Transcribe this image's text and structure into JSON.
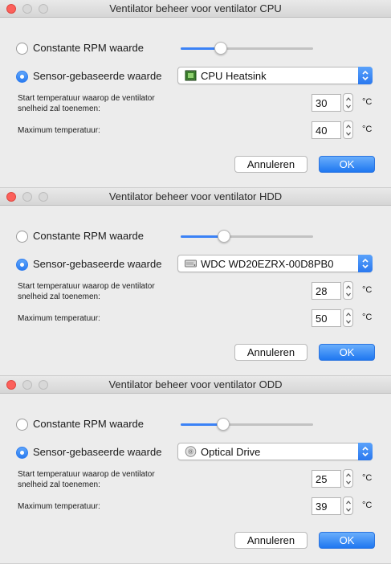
{
  "dialogs": [
    {
      "title": "Ventilator beheer voor ventilator CPU",
      "constant_label": "Constante RPM waarde",
      "sensor_label": "Sensor-gebaseerde waarde",
      "slider_level": 0.3,
      "selected_sensor": "CPU Heatsink",
      "sensor_icon": "chip-icon",
      "start_label_line1": "Start temperatuur waarop de ventilator",
      "start_label_line2": "snelheid zal toenemen:",
      "start_value": "30",
      "max_label": "Maximum temperatuur:",
      "max_value": "40",
      "unit": "°C",
      "cancel_label": "Annuleren",
      "ok_label": "OK"
    },
    {
      "title": "Ventilator beheer voor ventilator HDD",
      "constant_label": "Constante RPM waarde",
      "sensor_label": "Sensor-gebaseerde waarde",
      "slider_level": 0.33,
      "selected_sensor": "WDC WD20EZRX-00D8PB0",
      "sensor_icon": "hard-drive-icon",
      "start_label_line1": "Start temperatuur waarop de ventilator",
      "start_label_line2": "snelheid zal toenemen:",
      "start_value": "28",
      "max_label": "Maximum temperatuur:",
      "max_value": "50",
      "unit": "°C",
      "cancel_label": "Annuleren",
      "ok_label": "OK"
    },
    {
      "title": "Ventilator beheer voor ventilator ODD",
      "constant_label": "Constante RPM waarde",
      "sensor_label": "Sensor-gebaseerde waarde",
      "slider_level": 0.32,
      "selected_sensor": "Optical Drive",
      "sensor_icon": "optical-disc-icon",
      "start_label_line1": "Start temperatuur waarop de ventilator",
      "start_label_line2": "snelheid zal toenemen:",
      "start_value": "25",
      "max_label": "Maximum temperatuur:",
      "max_value": "39",
      "unit": "°C",
      "cancel_label": "Annuleren",
      "ok_label": "OK"
    }
  ],
  "colors": {
    "accent": "#2a7bf0",
    "close_button": "#fc605b",
    "window_background": "#ececec"
  }
}
